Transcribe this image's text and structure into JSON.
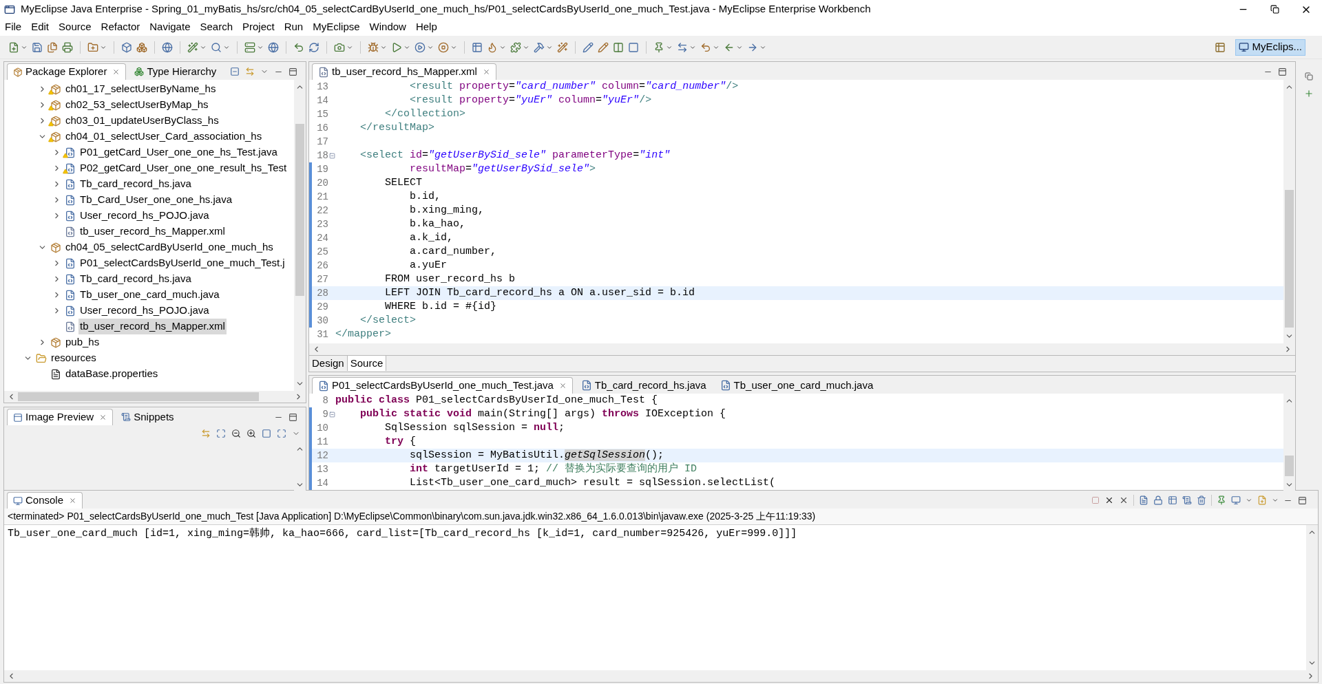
{
  "window": {
    "title": "MyEclipse Java Enterprise - Spring_01_myBatis_hs/src/ch04_05_selectCardByUserId_one_much_hs/P01_selectCardsByUserId_one_much_Test.java - MyEclipse Enterprise Workbench"
  },
  "menu": [
    "File",
    "Edit",
    "Source",
    "Refactor",
    "Navigate",
    "Search",
    "Project",
    "Run",
    "MyEclipse",
    "Window",
    "Help"
  ],
  "perspective": {
    "label": "MyEclips...",
    "selected": true
  },
  "package_explorer": {
    "tabs": [
      {
        "label": "Package Explorer",
        "selected": true
      },
      {
        "label": "Type Hierarchy",
        "selected": false
      }
    ],
    "tree": [
      {
        "kind": "group",
        "children": [
          {
            "label": "ch01_17_selectUserByName_hs",
            "kind": "package",
            "warning": true,
            "expanded": false,
            "selected": false
          },
          {
            "label": "ch02_53_selectUserByMap_hs",
            "kind": "package",
            "warning": true,
            "expanded": false,
            "selected": false
          },
          {
            "label": "ch03_01_updateUserByClass_hs",
            "kind": "package",
            "warning": true,
            "expanded": false,
            "selected": false
          },
          {
            "label": "ch04_01_selectUser_Card_association_hs",
            "kind": "package",
            "warning": true,
            "expanded": true,
            "selected": false,
            "children": [
              {
                "label": "P01_getCard_User_one_one_hs_Test.java",
                "kind": "java",
                "warning": true,
                "expanded": false,
                "selected": false
              },
              {
                "label": "P02_getCard_User_one_one_result_hs_Test",
                "kind": "java",
                "warning": true,
                "expanded": false,
                "selected": false
              },
              {
                "label": "Tb_card_record_hs.java",
                "kind": "java",
                "warning": false,
                "expanded": false,
                "selected": false
              },
              {
                "label": "Tb_Card_User_one_one_hs.java",
                "kind": "java",
                "warning": false,
                "expanded": false,
                "selected": false
              },
              {
                "label": "User_record_hs_POJO.java",
                "kind": "java",
                "warning": false,
                "expanded": false,
                "selected": false
              },
              {
                "label": "tb_user_record_hs_Mapper.xml",
                "kind": "xml",
                "warning": false,
                "selected": false
              }
            ]
          },
          {
            "label": "ch04_05_selectCardByUserId_one_much_hs",
            "kind": "package",
            "warning": false,
            "expanded": true,
            "selected": false,
            "children": [
              {
                "label": "P01_selectCardsByUserId_one_much_Test.j",
                "kind": "java",
                "warning": false,
                "expanded": false,
                "selected": false
              },
              {
                "label": "Tb_card_record_hs.java",
                "kind": "java",
                "warning": false,
                "expanded": false,
                "selected": false
              },
              {
                "label": "Tb_user_one_card_much.java",
                "kind": "java",
                "warning": false,
                "expanded": false,
                "selected": false
              },
              {
                "label": "User_record_hs_POJO.java",
                "kind": "java",
                "warning": false,
                "expanded": false,
                "selected": false
              },
              {
                "label": "tb_user_record_hs_Mapper.xml",
                "kind": "xml",
                "warning": false,
                "selected": true
              }
            ]
          },
          {
            "label": "pub_hs",
            "kind": "package",
            "warning": false,
            "expanded": false,
            "selected": false
          }
        ]
      },
      {
        "label": "resources",
        "kind": "source_folder",
        "warning": false,
        "expanded": true,
        "selected": false,
        "children": [
          {
            "label": "dataBase.properties",
            "kind": "properties",
            "warning": false,
            "selected": false
          }
        ]
      }
    ]
  },
  "image_preview": {
    "tabs": [
      {
        "label": "Image Preview",
        "selected": true
      },
      {
        "label": "Snippets",
        "selected": false
      }
    ]
  },
  "editor_top": {
    "tabs": [
      {
        "label": "tb_user_record_hs_Mapper.xml",
        "kind": "xml",
        "selected": true
      }
    ],
    "lines": [
      {
        "number": "13",
        "changed": false,
        "fold": false,
        "highlighted": false,
        "tokens": [
          {
            "kind": "tag",
            "text": "            <result"
          },
          {
            "kind": "attr",
            "text": " property"
          },
          {
            "kind": "plain",
            "text": "="
          },
          {
            "kind": "string",
            "text": "\"card_number\""
          },
          {
            "kind": "attr",
            "text": " column"
          },
          {
            "kind": "plain",
            "text": "="
          },
          {
            "kind": "string",
            "text": "\"card_number\""
          },
          {
            "kind": "tag",
            "text": "/>"
          }
        ]
      },
      {
        "number": "14",
        "changed": false,
        "fold": false,
        "highlighted": false,
        "tokens": [
          {
            "kind": "tag",
            "text": "            <result"
          },
          {
            "kind": "attr",
            "text": " property"
          },
          {
            "kind": "plain",
            "text": "="
          },
          {
            "kind": "string",
            "text": "\"yuEr\""
          },
          {
            "kind": "attr",
            "text": " column"
          },
          {
            "kind": "plain",
            "text": "="
          },
          {
            "kind": "string",
            "text": "\"yuEr\""
          },
          {
            "kind": "tag",
            "text": "/>"
          }
        ]
      },
      {
        "number": "15",
        "changed": false,
        "fold": false,
        "highlighted": false,
        "tokens": [
          {
            "kind": "tag",
            "text": "        </collection>"
          }
        ]
      },
      {
        "number": "16",
        "changed": false,
        "fold": false,
        "highlighted": false,
        "tokens": [
          {
            "kind": "tag",
            "text": "    </resultMap>"
          }
        ]
      },
      {
        "number": "17",
        "changed": false,
        "fold": false,
        "highlighted": false
      },
      {
        "number": "18",
        "changed": false,
        "fold": true,
        "highlighted": false,
        "tokens": [
          {
            "kind": "tag",
            "text": "    <select"
          },
          {
            "kind": "attr",
            "text": " id"
          },
          {
            "kind": "plain",
            "text": "="
          },
          {
            "kind": "string",
            "text": "\"getUserBySid_sele\""
          },
          {
            "kind": "attr",
            "text": " parameterType"
          },
          {
            "kind": "plain",
            "text": "="
          },
          {
            "kind": "string",
            "text": "\"int\""
          }
        ]
      },
      {
        "number": "19",
        "changed": true,
        "fold": false,
        "highlighted": false,
        "tokens": [
          {
            "kind": "attr",
            "text": "            resultMap"
          },
          {
            "kind": "plain",
            "text": "="
          },
          {
            "kind": "string",
            "text": "\"getUserBySid_sele\""
          },
          {
            "kind": "tag",
            "text": ">"
          }
        ]
      },
      {
        "number": "20",
        "changed": true,
        "fold": false,
        "highlighted": false,
        "tokens": [
          {
            "kind": "plain",
            "text": "        SELECT"
          }
        ]
      },
      {
        "number": "21",
        "changed": true,
        "fold": false,
        "highlighted": false,
        "tokens": [
          {
            "kind": "plain",
            "text": "            b.id,"
          }
        ]
      },
      {
        "number": "22",
        "changed": true,
        "fold": false,
        "highlighted": false,
        "tokens": [
          {
            "kind": "plain",
            "text": "            b.xing_ming,"
          }
        ]
      },
      {
        "number": "23",
        "changed": true,
        "fold": false,
        "highlighted": false,
        "tokens": [
          {
            "kind": "plain",
            "text": "            b.ka_hao,"
          }
        ]
      },
      {
        "number": "24",
        "changed": true,
        "fold": false,
        "highlighted": false,
        "tokens": [
          {
            "kind": "plain",
            "text": "            a.k_id,"
          }
        ]
      },
      {
        "number": "25",
        "changed": true,
        "fold": false,
        "highlighted": false,
        "tokens": [
          {
            "kind": "plain",
            "text": "            a.card_number,"
          }
        ]
      },
      {
        "number": "26",
        "changed": true,
        "fold": false,
        "highlighted": false,
        "tokens": [
          {
            "kind": "plain",
            "text": "            a.yuEr"
          }
        ]
      },
      {
        "number": "27",
        "changed": true,
        "fold": false,
        "highlighted": false,
        "tokens": [
          {
            "kind": "plain",
            "text": "        FROM user_record_hs b"
          }
        ]
      },
      {
        "number": "28",
        "changed": true,
        "fold": false,
        "highlighted": true,
        "tokens": [
          {
            "kind": "plain",
            "text": "        LEFT JOIN Tb_card_record_hs a ON a.user_sid = b.id"
          }
        ]
      },
      {
        "number": "29",
        "changed": true,
        "fold": false,
        "highlighted": false,
        "tokens": [
          {
            "kind": "plain",
            "text": "        WHERE b.id = #{id}"
          }
        ]
      },
      {
        "number": "30",
        "changed": true,
        "fold": false,
        "highlighted": false,
        "tokens": [
          {
            "kind": "tag",
            "text": "    </select>"
          }
        ]
      },
      {
        "number": "31",
        "changed": false,
        "fold": false,
        "highlighted": false,
        "tokens": [
          {
            "kind": "tag",
            "text": "</mapper>"
          }
        ]
      }
    ],
    "view_tabs": [
      {
        "label": "Design",
        "selected": false
      },
      {
        "label": "Source",
        "selected": true
      }
    ]
  },
  "editor_bottom": {
    "tabs": [
      {
        "label": "P01_selectCardsByUserId_one_much_Test.java",
        "kind": "java",
        "selected": true
      },
      {
        "label": "Tb_card_record_hs.java",
        "kind": "java",
        "selected": false
      },
      {
        "label": "Tb_user_one_card_much.java",
        "kind": "java",
        "selected": false
      }
    ],
    "lines": [
      {
        "number": "8",
        "changed": false,
        "fold": false,
        "highlighted": false,
        "tokens": [
          {
            "kind": "keyword",
            "text": "public"
          },
          {
            "kind": "keyword",
            "text": " class"
          },
          {
            "kind": "plain",
            "text": " P01_selectCardsByUserId_one_much_Test {"
          }
        ]
      },
      {
        "number": "9",
        "changed": true,
        "fold": true,
        "highlighted": false,
        "tokens": [
          {
            "kind": "keyword",
            "text": "    public"
          },
          {
            "kind": "keyword",
            "text": " static"
          },
          {
            "kind": "keyword",
            "text": " void"
          },
          {
            "kind": "plain",
            "text": " main(String[] args) "
          },
          {
            "kind": "keyword",
            "text": "throws"
          },
          {
            "kind": "plain",
            "text": " IOException {"
          }
        ]
      },
      {
        "number": "10",
        "changed": true,
        "fold": false,
        "highlighted": false,
        "tokens": [
          {
            "kind": "plain",
            "text": "        SqlSession sqlSession = "
          },
          {
            "kind": "keyword",
            "text": "null"
          },
          {
            "kind": "plain",
            "text": ";"
          }
        ]
      },
      {
        "number": "11",
        "changed": true,
        "fold": false,
        "highlighted": false,
        "tokens": [
          {
            "kind": "keyword",
            "text": "        try"
          },
          {
            "kind": "plain",
            "text": " {"
          }
        ]
      },
      {
        "number": "12",
        "changed": true,
        "fold": false,
        "highlighted": true,
        "tokens": [
          {
            "kind": "plain",
            "text": "            sqlSession = MyBatisUtil."
          },
          {
            "kind": "marked",
            "text": "getSqlSession"
          },
          {
            "kind": "plain",
            "text": "();"
          }
        ]
      },
      {
        "number": "13",
        "changed": true,
        "fold": false,
        "highlighted": false,
        "tokens": [
          {
            "kind": "keyword",
            "text": "            int"
          },
          {
            "kind": "plain",
            "text": " targetUserId = 1; "
          },
          {
            "kind": "comment",
            "text": "// 替换为实际要查询的用户 ID"
          }
        ]
      },
      {
        "number": "14",
        "changed": true,
        "fold": false,
        "highlighted": false,
        "tokens": [
          {
            "kind": "plain",
            "text": "            List<Tb_user_one_card_much> result = sqlSession.selectList("
          }
        ]
      }
    ]
  },
  "console": {
    "tab": {
      "label": "Console",
      "selected": true
    },
    "header": "<terminated> P01_selectCardsByUserId_one_much_Test [Java Application] D:\\MyEclipse\\Common\\binary\\com.sun.java.jdk.win32.x86_64_1.6.0.013\\bin\\javaw.exe (2025-3-25 上午11:19:33)",
    "output": [
      "Tb_user_one_card_much [id=1, xing_ming=韩帅, ka_hao=666, card_list=[Tb_card_record_hs [k_id=1, card_number=925426, yuEr=999.0]]]"
    ]
  }
}
